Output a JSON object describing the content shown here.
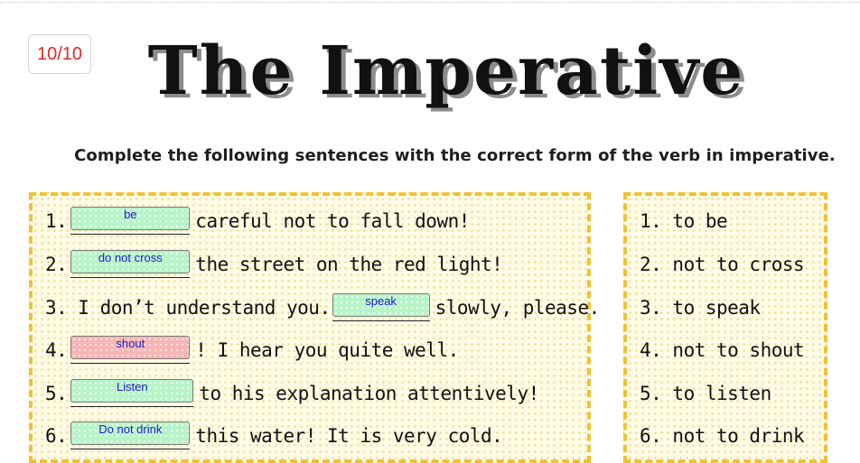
{
  "score": "10/10",
  "title": "The Imperative",
  "instructions": "Complete the following sentences with the correct form of the verb in imperative.",
  "colors": {
    "correct": "#b9f3c8",
    "incorrect": "#f6b6b4",
    "answer_text": "#1b1bd6",
    "score": "#e0282e",
    "panel_border": "#f0c233"
  },
  "exercise": {
    "items": [
      {
        "num": "1.",
        "before": "",
        "answer": "be",
        "status": "correct",
        "after": "careful not to fall down!"
      },
      {
        "num": "2.",
        "before": "",
        "answer": "do not cross",
        "status": "correct",
        "after": "the street on the red light!"
      },
      {
        "num": "3.",
        "before": "I don’t understand you.",
        "answer": "speak",
        "status": "correct",
        "after": "slowly, please."
      },
      {
        "num": "4.",
        "before": "",
        "answer": "shout",
        "status": "incorrect",
        "after": "! I hear you quite well."
      },
      {
        "num": "5.",
        "before": "",
        "answer": "Listen",
        "status": "correct",
        "after": "to his explanation attentively!"
      },
      {
        "num": "6.",
        "before": "",
        "answer": "Do not drink",
        "status": "correct",
        "after": "this water! It is very cold."
      }
    ]
  },
  "key": {
    "items": [
      "1. to be",
      "2. not to cross",
      "3. to speak",
      "4. not to shout",
      "5. to listen",
      "6. not to drink"
    ]
  }
}
